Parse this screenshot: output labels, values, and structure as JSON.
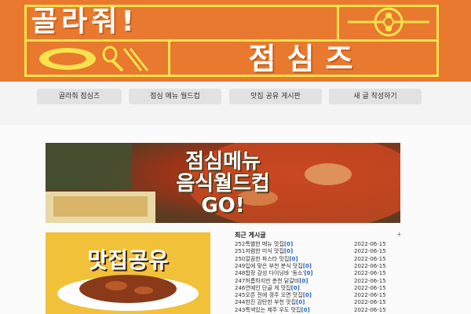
{
  "header": {
    "title_top": "골라줘!",
    "title_bottom": "점심즈"
  },
  "nav": {
    "items": [
      {
        "label": "골라줘 점심즈"
      },
      {
        "label": "점심 메뉴 월드컵"
      },
      {
        "label": "맛집 공유 게시판"
      },
      {
        "label": "새 글 작성하기"
      }
    ]
  },
  "banners": {
    "worldcup": "점심메뉴\n음식월드컵\nGO!",
    "share": "맛집공유"
  },
  "recent": {
    "title": "최근 게시글",
    "more": "+",
    "posts": [
      {
        "id": "252",
        "title": "특별한 메뉴 맛집",
        "comments": "[0]",
        "date": "2022-06-15"
      },
      {
        "id": "251",
        "title": "저렴한 미식 맛집",
        "comments": "[0]",
        "date": "2022-06-15"
      },
      {
        "id": "250",
        "title": "깔끔한 파스타 맛집",
        "comments": "[0]",
        "date": "2022-06-15"
      },
      {
        "id": "249",
        "title": "입에 맞은 부천 분식 맛집",
        "comments": "[0]",
        "date": "2022-06-15"
      },
      {
        "id": "248",
        "title": "합정 감성 다이닝바 '동소'",
        "comments": "[0]",
        "date": "2022-06-15"
      },
      {
        "id": "247",
        "title": "허름하지만 춘천 닭갈비",
        "comments": "[0]",
        "date": "2022-06-15"
      },
      {
        "id": "246",
        "title": "연예인 단골 게 맛집",
        "comments": "[0]",
        "date": "2022-06-15"
      },
      {
        "id": "245",
        "title": "오픈 전에 경주 오면 맛집",
        "comments": "[0]",
        "date": "2022-06-15"
      },
      {
        "id": "244",
        "title": "한진 감탄한 부천 맛집",
        "comments": "[0]",
        "date": "2022-06-15"
      },
      {
        "id": "243",
        "title": "특색있는 제주 우도 맛집",
        "comments": "[0]",
        "date": "2022-06-15"
      }
    ]
  },
  "colors": {
    "banner_bg": "#e8792e",
    "banner_line": "#f8e24e",
    "link_blue": "#2a66c8"
  }
}
